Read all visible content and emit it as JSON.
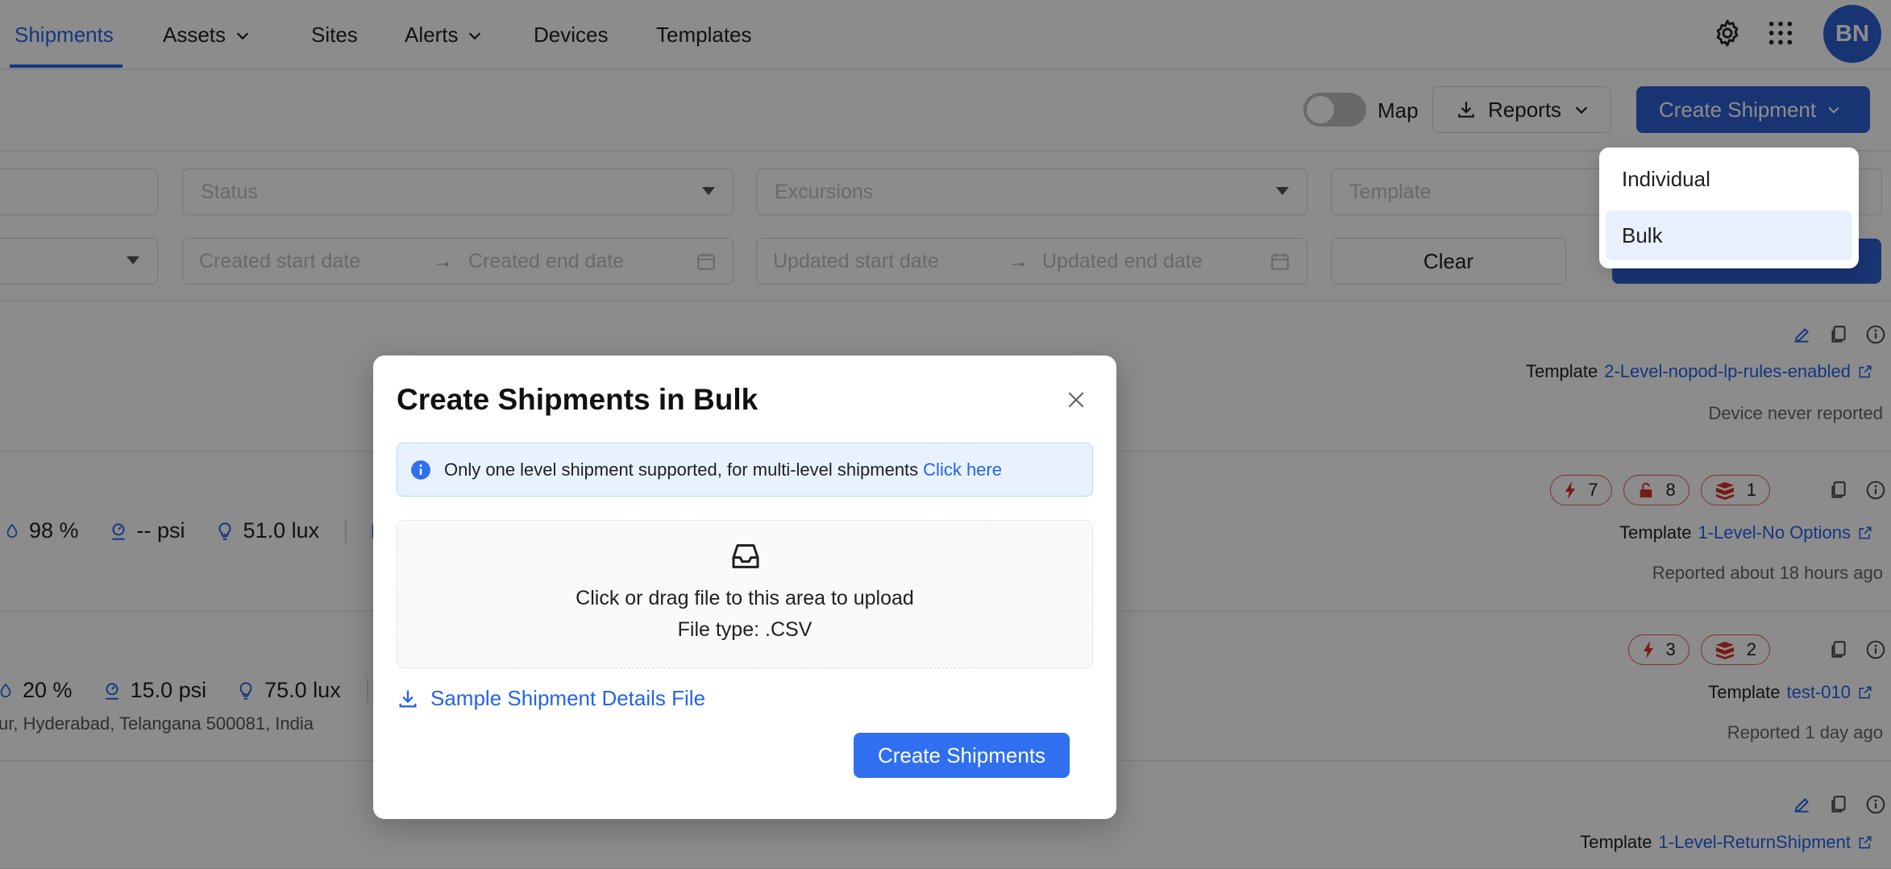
{
  "nav": {
    "tabs": [
      {
        "label": "Shipments"
      },
      {
        "label": "Assets"
      },
      {
        "label": "Sites"
      },
      {
        "label": "Alerts"
      },
      {
        "label": "Devices"
      },
      {
        "label": "Templates"
      }
    ],
    "avatar_initials": "BN"
  },
  "toolbar": {
    "map_label": "Map",
    "reports_label": "Reports",
    "create_label": "Create Shipment"
  },
  "filters": {
    "status_placeholder": "Status",
    "excursions_placeholder": "Excursions",
    "template_placeholder": "Template",
    "created_start": "Created start date",
    "created_end": "Created end date",
    "updated_start": "Updated start date",
    "updated_end": "Updated end date",
    "clear_label": "Clear",
    "arrow": "→"
  },
  "rows": [
    {
      "template_label": "Template",
      "template_name": "2-Level-nopod-lp-rules-enabled",
      "status": "Device never reported"
    },
    {
      "humidity": "98 %",
      "pressure": "-- psi",
      "light": "51.0 lux",
      "badges": [
        "7",
        "8",
        "1"
      ],
      "template_label": "Template",
      "template_name": "1-Level-No Options",
      "status": "Reported about 18 hours ago"
    },
    {
      "humidity": "20 %",
      "pressure": "15.0 psi",
      "light": "75.0 lux",
      "address": "ur, Hyderabad, Telangana 500081, India",
      "badges": [
        "3",
        "2"
      ],
      "template_label": "Template",
      "template_name": "test-010",
      "status": "Reported 1 day ago"
    },
    {
      "template_label": "Template",
      "template_name": "1-Level-ReturnShipment"
    }
  ],
  "dropdown": {
    "items": [
      {
        "label": "Individual"
      },
      {
        "label": "Bulk"
      }
    ]
  },
  "modal": {
    "title": "Create Shipments in Bulk",
    "info_text": "Only one level shipment supported, for multi-level shipments",
    "info_link": "Click here",
    "upload_line1": "Click or drag file to this area to upload",
    "upload_line2": "File type: .CSV",
    "sample_link": "Sample Shipment Details File",
    "submit_label": "Create Shipments"
  },
  "colors": {
    "primary": "#2f5fd0",
    "link": "#2563eb",
    "badge_border": "#e35d5d",
    "badge_icon": "#d93025"
  }
}
